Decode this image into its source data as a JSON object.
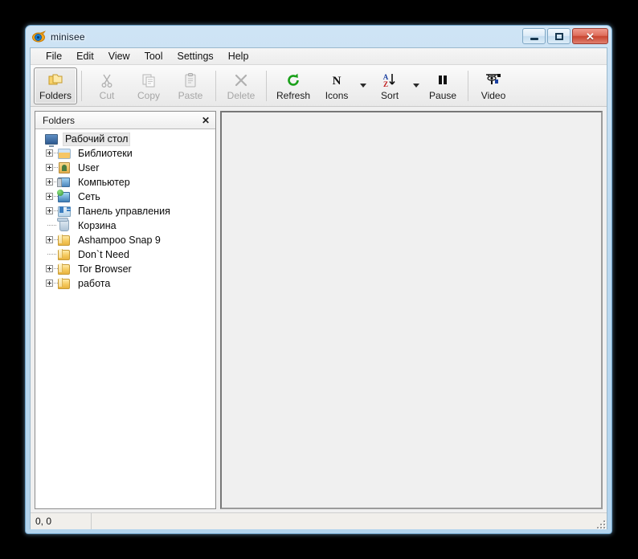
{
  "window": {
    "title": "minisee",
    "icon": "app-eye-icon",
    "controls": {
      "minimize": "–",
      "maximize": "□",
      "close": "✕"
    }
  },
  "menubar": {
    "items": [
      {
        "label": "File"
      },
      {
        "label": "Edit"
      },
      {
        "label": "View"
      },
      {
        "label": "Tool"
      },
      {
        "label": "Settings"
      },
      {
        "label": "Help"
      }
    ]
  },
  "toolbar": {
    "buttons": [
      {
        "label": "Folders",
        "icon": "folders-icon",
        "state": "pressed"
      },
      {
        "label": "Cut",
        "icon": "scissors-icon",
        "state": "disabled"
      },
      {
        "label": "Copy",
        "icon": "copy-icon",
        "state": "disabled"
      },
      {
        "label": "Paste",
        "icon": "clipboard-icon",
        "state": "disabled"
      },
      {
        "label": "Delete",
        "icon": "x-delete-icon",
        "state": "disabled"
      },
      {
        "label": "Refresh",
        "icon": "refresh-icon",
        "state": "enabled"
      },
      {
        "label": "Icons",
        "icon": "letter-n-icon",
        "state": "enabled"
      },
      {
        "label": "Sort",
        "icon": "sort-az-icon",
        "state": "enabled"
      },
      {
        "label": "Pause",
        "icon": "pause-icon",
        "state": "enabled"
      },
      {
        "label": "Video",
        "icon": "video-camera-icon",
        "state": "enabled"
      }
    ]
  },
  "folders_pane": {
    "title": "Folders",
    "close_label": "✕",
    "tree": [
      {
        "label": "Рабочий стол",
        "icon": "desktop-icon",
        "depth": 0,
        "expandable": false,
        "selected": true
      },
      {
        "label": "Библиотеки",
        "icon": "library-icon",
        "depth": 1,
        "expandable": true,
        "selected": false
      },
      {
        "label": "User",
        "icon": "user-icon",
        "depth": 1,
        "expandable": true,
        "selected": false
      },
      {
        "label": "Компьютер",
        "icon": "computer-icon",
        "depth": 1,
        "expandable": true,
        "selected": false
      },
      {
        "label": "Сеть",
        "icon": "network-icon",
        "depth": 1,
        "expandable": true,
        "selected": false
      },
      {
        "label": "Панель управления",
        "icon": "control-panel-icon",
        "depth": 1,
        "expandable": true,
        "selected": false
      },
      {
        "label": "Корзина",
        "icon": "recycle-bin-icon",
        "depth": 1,
        "expandable": false,
        "selected": false
      },
      {
        "label": "Ashampoo Snap 9",
        "icon": "folder-icon",
        "depth": 1,
        "expandable": true,
        "selected": false
      },
      {
        "label": "Don`t Need",
        "icon": "folder-icon",
        "depth": 1,
        "expandable": false,
        "selected": false
      },
      {
        "label": "Tor Browser",
        "icon": "folder-icon",
        "depth": 1,
        "expandable": true,
        "selected": false
      },
      {
        "label": "работа",
        "icon": "folder-icon",
        "depth": 1,
        "expandable": true,
        "selected": false
      }
    ]
  },
  "statusbar": {
    "coordinates": "0, 0",
    "secondary": ""
  },
  "colors": {
    "frame": "#b3d4ee",
    "close_button": "#c8442f",
    "refresh_green": "#19a019",
    "sort_a_blue": "#1a3fa0",
    "sort_z_red": "#c01818",
    "folder_yellow": "#f5c95c",
    "desktop_background": "#000000"
  }
}
